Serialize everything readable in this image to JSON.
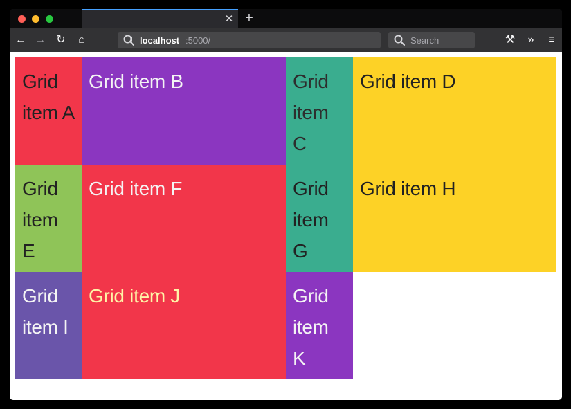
{
  "browser": {
    "tab": {
      "close_glyph": "✕",
      "new_tab_glyph": "+"
    },
    "toolbar": {
      "back_glyph": "←",
      "forward_glyph": "→",
      "reload_glyph": "↻",
      "home_glyph": "⌂",
      "tools_glyph": "⚒",
      "overflow_glyph": "»",
      "menu_glyph": "≡"
    },
    "url": {
      "host": "localhost",
      "path": ":5000/"
    },
    "search": {
      "placeholder": "Search"
    }
  },
  "grid": {
    "items": [
      {
        "label": "Grid item A",
        "bg": "#f2364a",
        "fg": "#222222"
      },
      {
        "label": "Grid item B",
        "bg": "#8b36c0",
        "fg": "#f4f4f4"
      },
      {
        "label": "Grid item C",
        "bg": "#3aad8f",
        "fg": "#2d2d2d"
      },
      {
        "label": "Grid item D",
        "bg": "#fdd226",
        "fg": "#222222"
      },
      {
        "label": "Grid item E",
        "bg": "#8fc458",
        "fg": "#222222"
      },
      {
        "label": "Grid item F",
        "bg": "#f2364a",
        "fg": "#f4f4f4"
      },
      {
        "label": "Grid item G",
        "bg": "#3aad8f",
        "fg": "#222222"
      },
      {
        "label": "Grid item H",
        "bg": "#fdd226",
        "fg": "#222222"
      },
      {
        "label": "Grid item I",
        "bg": "#6a55aa",
        "fg": "#f4f4f4"
      },
      {
        "label": "Grid item J",
        "bg": "#f2364a",
        "fg": "#fff5a8"
      },
      {
        "label": "Grid item K",
        "bg": "#8b36c0",
        "fg": "#f4f4f4"
      }
    ]
  }
}
